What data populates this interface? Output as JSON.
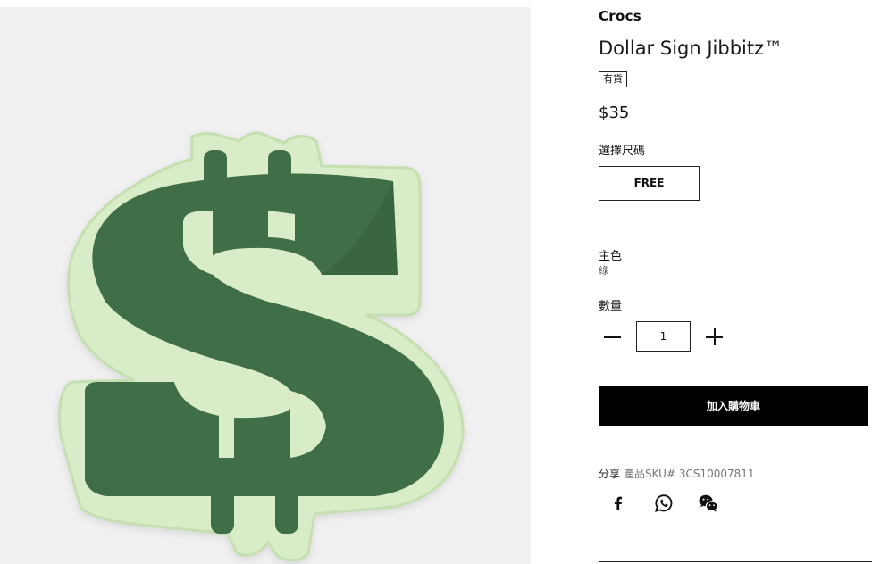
{
  "product": {
    "brand": "Crocs",
    "title": "Dollar Sign Jibbitz™",
    "stock_badge": "有貨",
    "price": "$35"
  },
  "size": {
    "label": "選擇尺碼",
    "options": [
      "FREE"
    ]
  },
  "color": {
    "label": "主色",
    "value": "綠"
  },
  "quantity": {
    "label": "數量",
    "value": "1"
  },
  "cart": {
    "button_label": "加入購物車"
  },
  "share": {
    "label": "分享",
    "sku_text": "產品SKU# 3CS10007811"
  },
  "social_icons": [
    "facebook-icon",
    "whatsapp-icon",
    "wechat-icon"
  ],
  "colors": {
    "image_background": "#f0f0f0",
    "dollar_green": "#3f6e47",
    "dollar_outline": "#d7ecc6",
    "button_black": "#000000"
  }
}
